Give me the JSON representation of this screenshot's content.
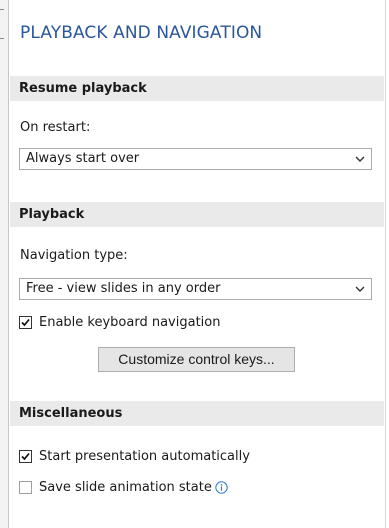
{
  "panel": {
    "title": "PLAYBACK AND NAVIGATION"
  },
  "resume": {
    "header": "Resume playback",
    "on_restart_label": "On restart:",
    "on_restart_value": "Always start over"
  },
  "playback": {
    "header": "Playback",
    "navigation_type_label": "Navigation type:",
    "navigation_type_value": "Free - view slides in any order",
    "keyboard_nav_label": "Enable keyboard navigation",
    "keyboard_nav_checked": true,
    "customize_button": "Customize control keys..."
  },
  "misc": {
    "header": "Miscellaneous",
    "start_auto_label": "Start presentation automatically",
    "start_auto_checked": true,
    "save_anim_label": "Save slide animation state",
    "save_anim_checked": false
  },
  "colors": {
    "title": "#2b579a",
    "section_bg": "#eaeaea",
    "info_icon": "#2b7cd3"
  },
  "icons": {
    "dropdown": "chevron-down-icon",
    "check": "checkmark-icon",
    "info": "info-icon"
  }
}
